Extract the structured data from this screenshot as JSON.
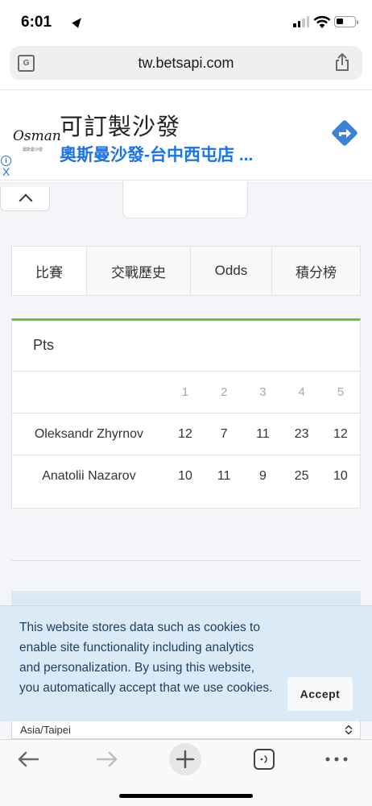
{
  "status_bar": {
    "time": "6:01"
  },
  "browser": {
    "url": "tw.betsapi.com"
  },
  "ad": {
    "logo": "Osman",
    "logo_sub": "奧斯曼沙發",
    "title": "可訂製沙發",
    "subtitle": "奧斯曼沙發-台中西屯店 ...",
    "info": "i",
    "close": "X"
  },
  "tabs": [
    {
      "label": "比賽",
      "active": true
    },
    {
      "label": "交戰歷史",
      "active": false
    },
    {
      "label": "Odds",
      "active": false
    },
    {
      "label": "積分榜",
      "active": false
    }
  ],
  "pts_table": {
    "title": "Pts",
    "columns": [
      "1",
      "2",
      "3",
      "4",
      "5"
    ],
    "rows": [
      {
        "name": "Oleksandr Zhyrnov",
        "values": [
          "12",
          "7",
          "11",
          "23",
          "12"
        ]
      },
      {
        "name": "Anatolii Nazarov",
        "values": [
          "10",
          "11",
          "9",
          "25",
          "10"
        ]
      }
    ]
  },
  "cookie": {
    "text": "This website stores data such as cookies to enable site functionality including analytics and personalization. By using this website, you automatically accept that we use cookies.",
    "accept_label": "Accept"
  },
  "timezone": {
    "value": "Asia/Taipei"
  },
  "colors": {
    "accent_green": "#6cbf45",
    "link_blue": "#1a73e8",
    "cookie_bg": "#dbeaf7"
  }
}
